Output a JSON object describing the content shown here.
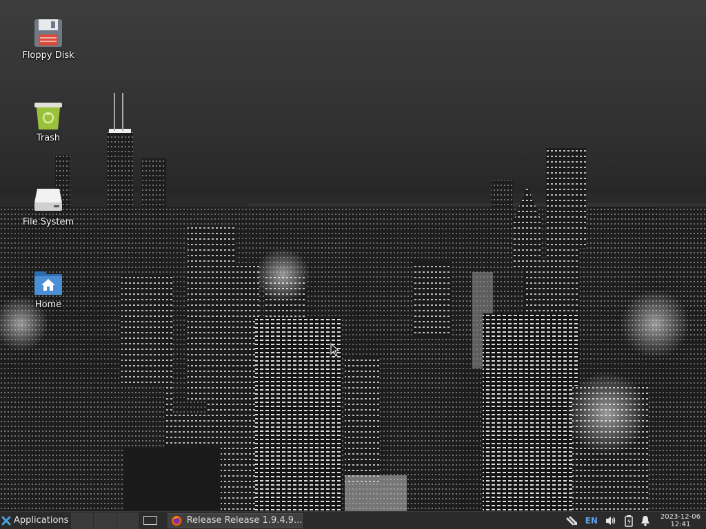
{
  "desktop": {
    "icons": [
      {
        "label": "Floppy Disk",
        "icon": "floppy-disk-icon"
      },
      {
        "label": "Trash",
        "icon": "trash-icon"
      },
      {
        "label": "File System",
        "icon": "file-system-icon"
      },
      {
        "label": "Home",
        "icon": "home-folder-icon"
      }
    ],
    "wallpaper": "night-city-skyline-monochrome"
  },
  "taskbar": {
    "applications_label": "Applications",
    "window_title": "Release Release 1.9.4.9...",
    "language": "EN",
    "clock_date": "2023-12-06",
    "clock_time": "12:41"
  },
  "colors": {
    "taskbar_bg": "#2b2b2b",
    "accent_blue": "#5fa4e6",
    "trash_green": "#9ac13c",
    "folder_blue": "#4b8fd6"
  }
}
